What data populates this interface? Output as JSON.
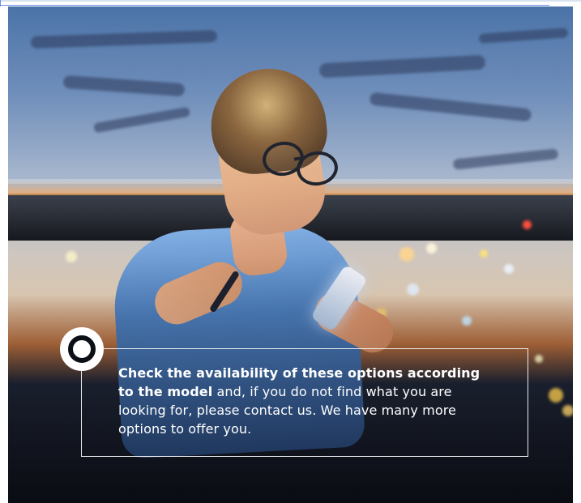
{
  "content": {
    "message_bold": "Check the availability of these options according to the model",
    "message_rest": " and, if you do not find what you are looking for, please contact us. We have many more options to offer you."
  }
}
